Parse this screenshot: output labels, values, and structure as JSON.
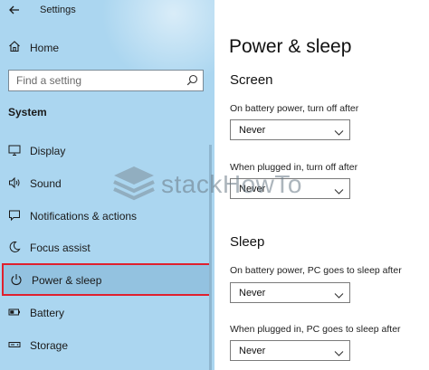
{
  "app": {
    "title": "Settings"
  },
  "sidebar": {
    "home_label": "Home",
    "search_placeholder": "Find a setting",
    "section_heading": "System",
    "items": [
      {
        "label": "Display",
        "icon": "display-icon"
      },
      {
        "label": "Sound",
        "icon": "speaker-icon"
      },
      {
        "label": "Notifications & actions",
        "icon": "notification-icon"
      },
      {
        "label": "Focus assist",
        "icon": "moon-icon"
      },
      {
        "label": "Power & sleep",
        "icon": "power-icon",
        "selected": true
      },
      {
        "label": "Battery",
        "icon": "battery-icon"
      },
      {
        "label": "Storage",
        "icon": "storage-icon"
      }
    ],
    "selected_color": "#e0202e"
  },
  "main": {
    "title": "Power & sleep",
    "screen": {
      "heading": "Screen",
      "battery_label": "On battery power, turn off after",
      "battery_value": "Never",
      "plugged_label": "When plugged in, turn off after",
      "plugged_value": "Never"
    },
    "sleep": {
      "heading": "Sleep",
      "battery_label": "On battery power, PC goes to sleep after",
      "battery_value": "Never",
      "plugged_label": "When plugged in, PC goes to sleep after",
      "plugged_value": "Never"
    }
  },
  "watermark": {
    "text": "stackHowTo"
  },
  "colors": {
    "sidebar_bg": "#abd6f0",
    "accent": "#e0202e"
  }
}
